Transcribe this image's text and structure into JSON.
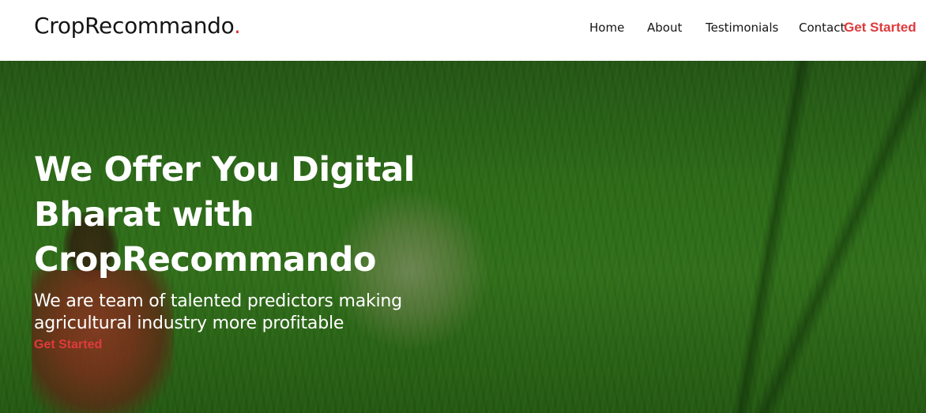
{
  "header": {
    "logo_text": "CropRecommando",
    "logo_dot": ".",
    "nav": {
      "home": "Home",
      "about": "About",
      "testimonials": "Testimonials",
      "contact": "Contact",
      "cta": "Get Started"
    }
  },
  "hero": {
    "title": "We Offer You Digital Bharat with CropRecommando",
    "subtitle": "We are team of talented predictors making agricultural industry more profitable",
    "cta": "Get Started"
  },
  "colors": {
    "accent": "#e03a3c",
    "text_dark": "#151515",
    "hero_text": "#ffffff"
  }
}
